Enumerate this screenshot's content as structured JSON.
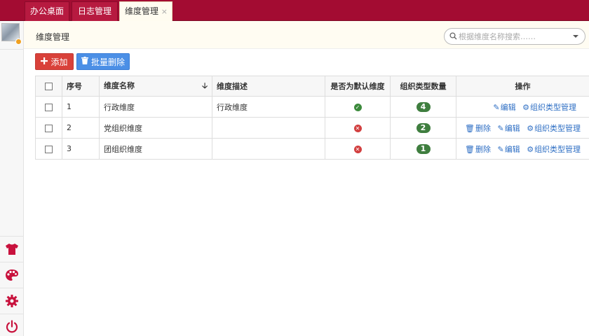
{
  "tabs": [
    {
      "label": "办公桌面"
    },
    {
      "label": "日志管理"
    },
    {
      "label": "维度管理",
      "close": "×"
    }
  ],
  "header": {
    "title": "维度管理",
    "search_placeholder": "根据维度名称搜索……"
  },
  "toolbar": {
    "add_label": "添加",
    "batch_delete_label": "批量删除"
  },
  "table": {
    "columns": [
      "序号",
      "维度名称",
      "维度描述",
      "是否为默认维度",
      "组织类型数量",
      "操作"
    ],
    "rows": [
      {
        "index": "1",
        "name": "行政维度",
        "desc": "行政维度",
        "is_default": true,
        "count": "4",
        "can_delete": false
      },
      {
        "index": "2",
        "name": "党组织维度",
        "desc": "",
        "is_default": false,
        "count": "2",
        "can_delete": true
      },
      {
        "index": "3",
        "name": "团组织维度",
        "desc": "",
        "is_default": false,
        "count": "1",
        "can_delete": true
      }
    ],
    "actions": {
      "delete": "删除",
      "edit": "编辑",
      "org_type": "组织类型管理"
    }
  },
  "sidebar": {
    "icons": [
      "shirt-icon",
      "palette-icon",
      "gear-icon",
      "power-icon"
    ]
  },
  "colors": {
    "brand": "#a30c32",
    "accent_red": "#d9413a",
    "accent_blue": "#4b8fe6",
    "sidebar_icon": "#c8123d",
    "badge_green": "#3f7e3f"
  }
}
